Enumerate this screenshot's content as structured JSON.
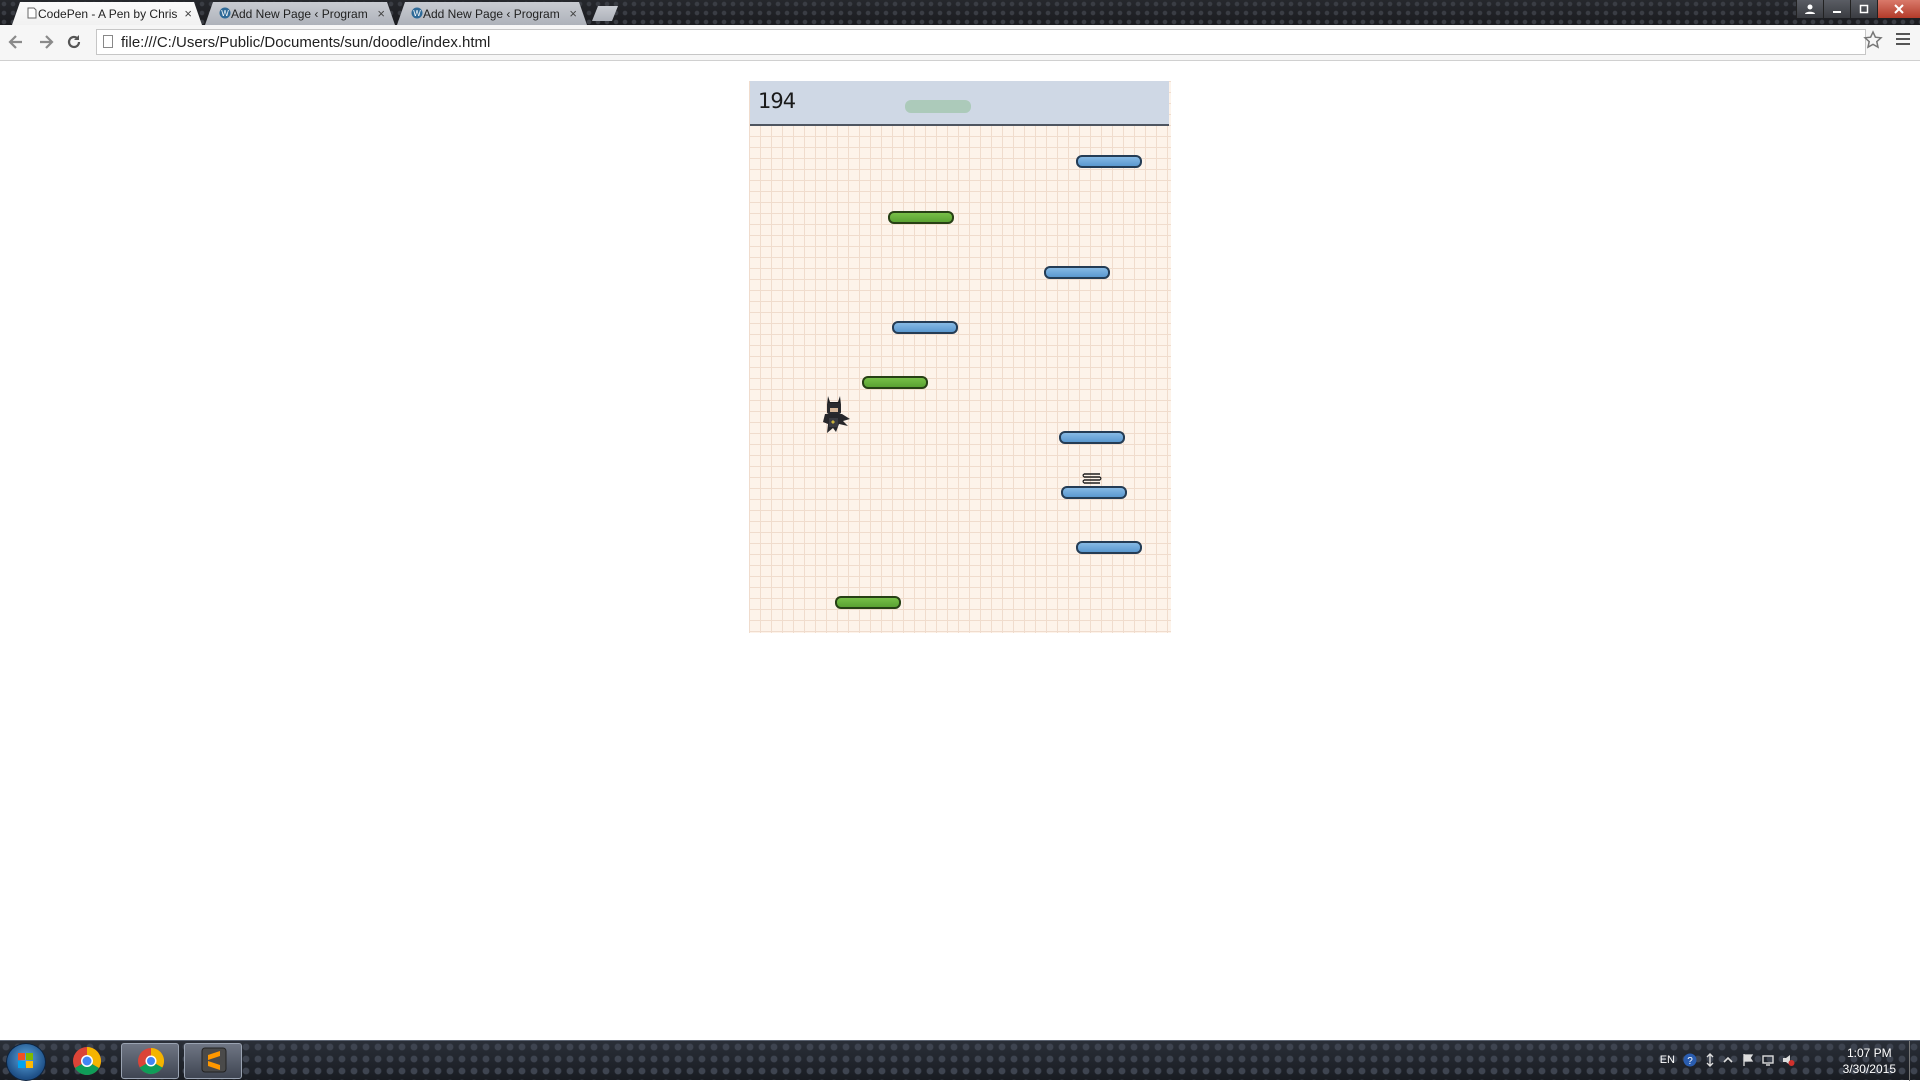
{
  "browser": {
    "tabs": [
      {
        "label": "CodePen - A Pen by Chris",
        "active": true
      },
      {
        "label": "Add New Page ‹ Program",
        "active": false
      },
      {
        "label": "Add New Page ‹ Program",
        "active": false
      }
    ],
    "tab_close_glyph": "×",
    "url": "file:///C:/Users/Public/Documents/sun/doodle/index.html",
    "icons": {
      "back": "back-arrow-icon",
      "forward": "forward-arrow-icon",
      "reload": "reload-icon",
      "bookmark": "star-icon",
      "menu": "hamburger-menu-icon"
    }
  },
  "game": {
    "score": "194",
    "colors": {
      "grid_background": "#fdf3ea",
      "score_bar": "#cfd8e5",
      "green_platform": "#6bb13d",
      "blue_platform": "#6fa7d9"
    },
    "platform_types": [
      "ghost",
      "blue",
      "green",
      "blue",
      "blue",
      "green",
      "blue",
      "blue",
      "blue",
      "green"
    ],
    "has_spring": true,
    "player": "batman-doodler"
  },
  "taskbar": {
    "apps": [
      "chrome",
      "chrome",
      "sublime-text"
    ],
    "language": "EN",
    "time": "1:07 PM",
    "date": "3/30/2015"
  }
}
